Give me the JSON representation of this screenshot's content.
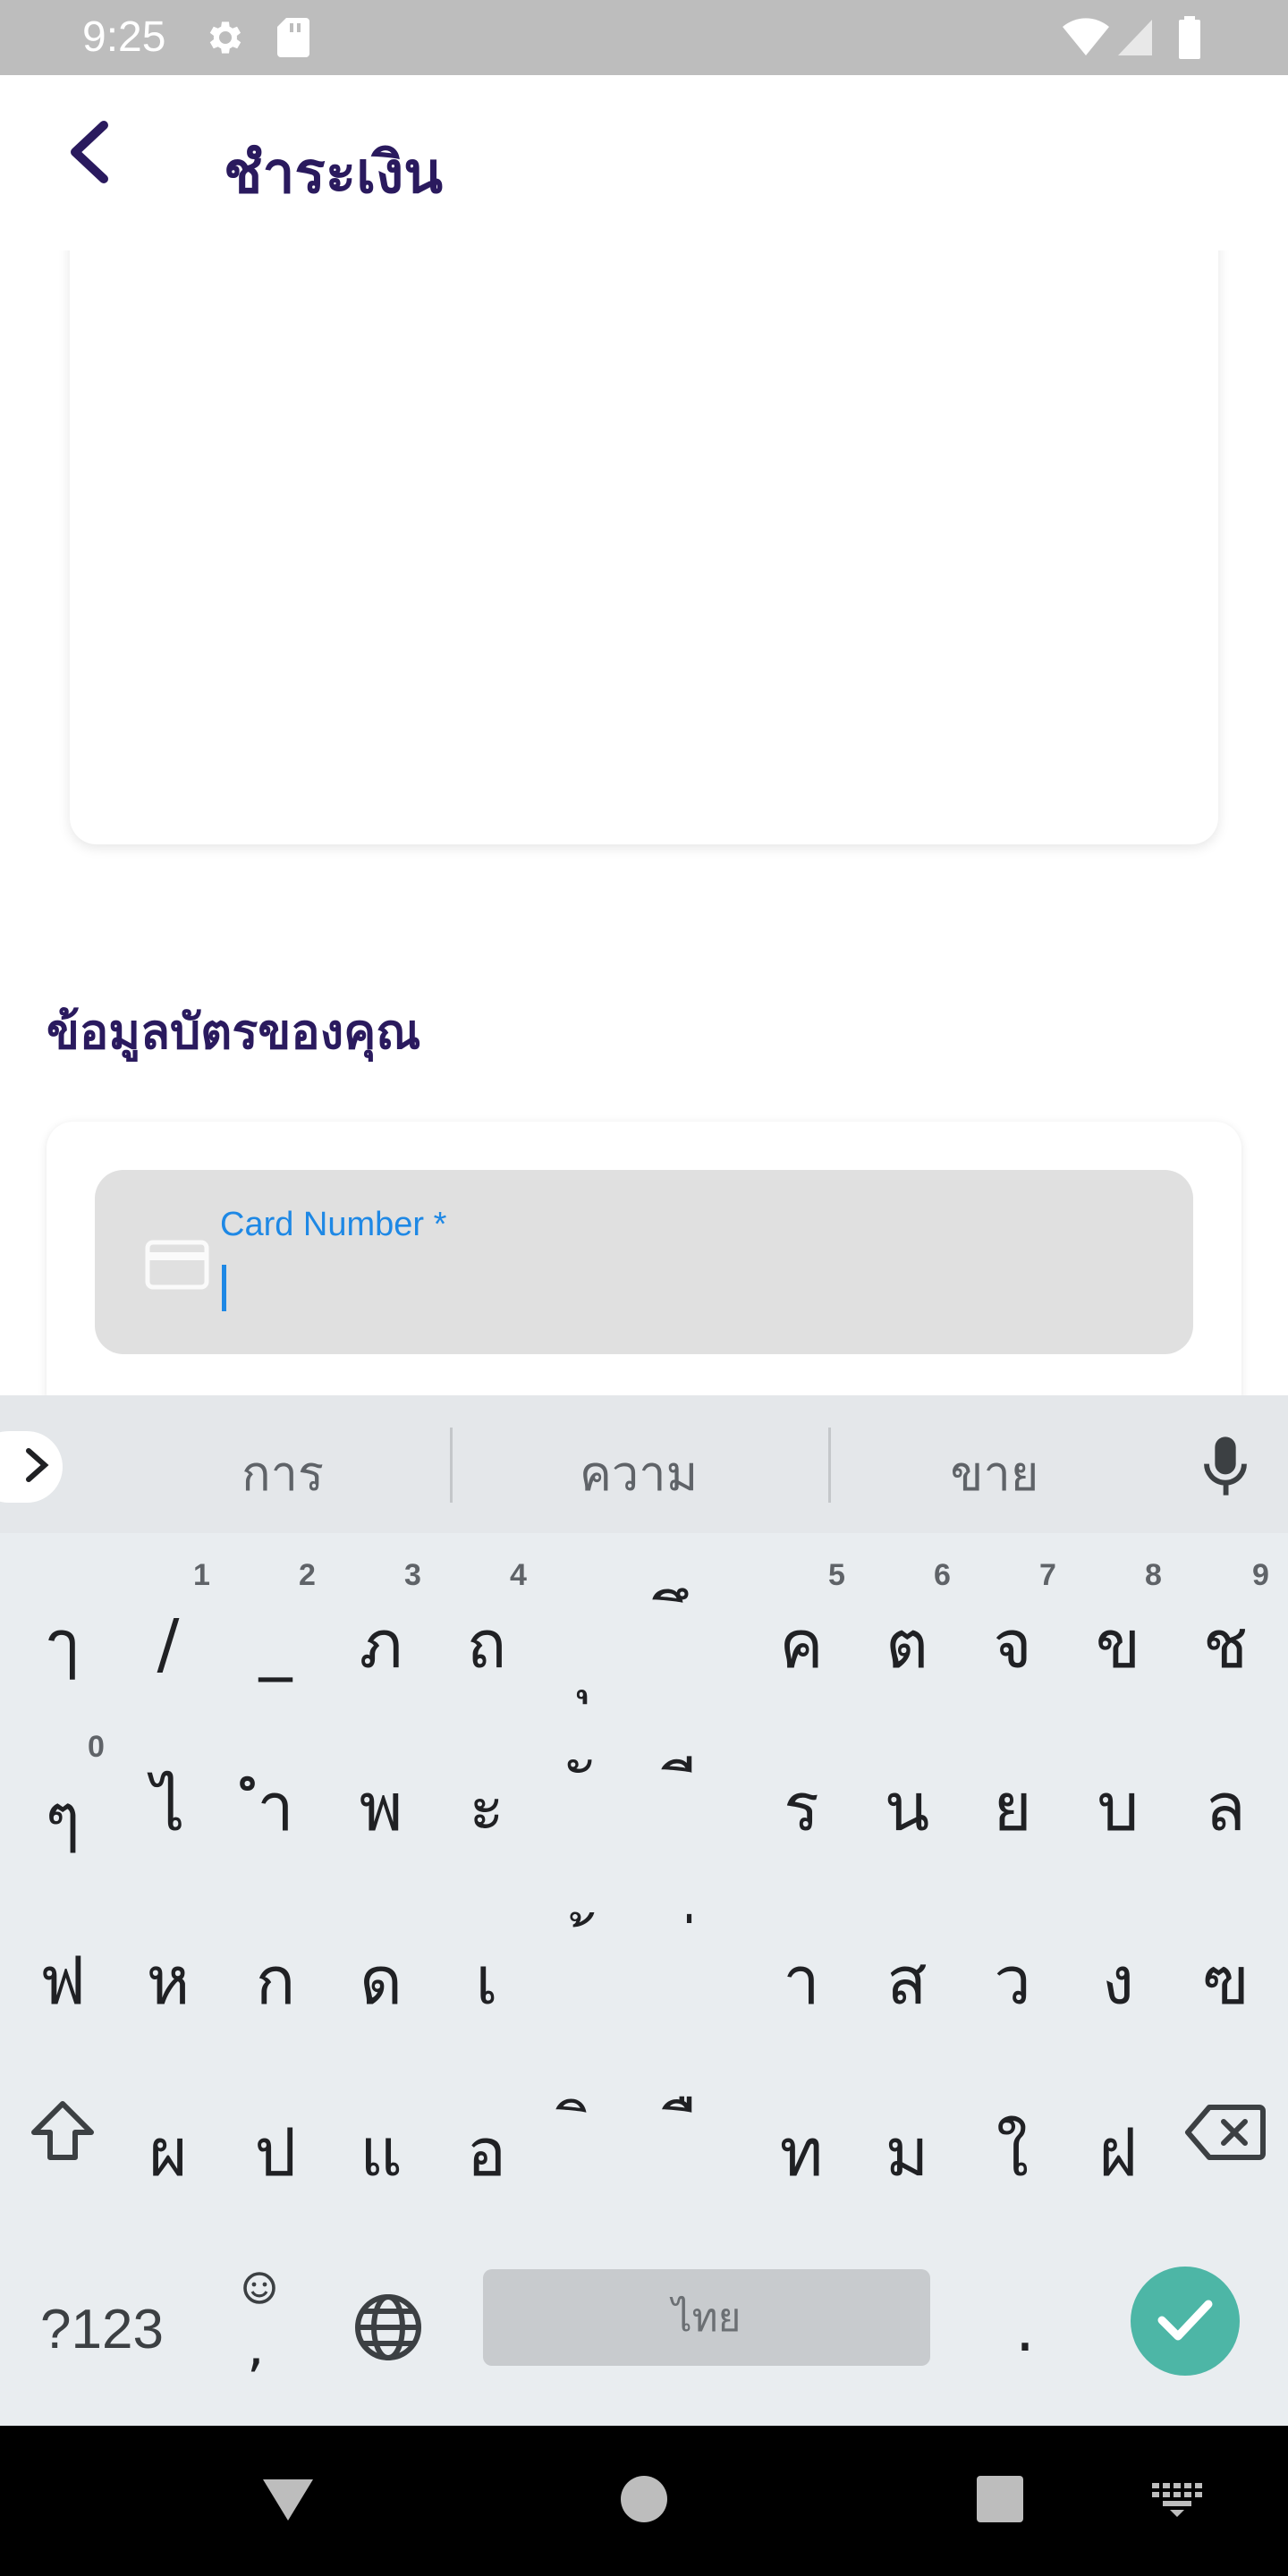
{
  "status_bar": {
    "time": "9:25",
    "left_icons": [
      "settings-icon",
      "sd-card-icon"
    ],
    "right_icons": [
      "wifi-icon",
      "signal-icon",
      "battery-icon"
    ]
  },
  "app_bar": {
    "title": "ชำระเงิน",
    "back_icon": "chevron-left-icon"
  },
  "section": {
    "title": "ข้อมูลบัตรของคุณ"
  },
  "card_form": {
    "card_number_label": "Card Number *",
    "card_number_value": "",
    "card_icon": "credit-card-icon"
  },
  "keyboard": {
    "suggestions": [
      "การ",
      "ความ",
      "ขาย"
    ],
    "rows": [
      {
        "keys": [
          "ๅ",
          "/",
          "_",
          "ภ",
          "ถ",
          "ุ",
          "ึ",
          "ค",
          "ต",
          "จ",
          "ข",
          "ช"
        ],
        "hints": [
          "",
          "1",
          "2",
          "3",
          "4",
          "",
          "",
          "5",
          "6",
          "7",
          "8",
          "9"
        ]
      },
      {
        "keys": [
          "ๆ",
          "ไ",
          "ำ",
          "พ",
          "ะ",
          "ั",
          "ี",
          "ร",
          "น",
          "ย",
          "บ",
          "ล"
        ],
        "hints": [
          "0",
          "",
          "",
          "",
          "",
          "",
          "",
          "",
          "",
          "",
          "",
          ""
        ]
      },
      {
        "keys": [
          "ฟ",
          "ห",
          "ก",
          "ด",
          "เ",
          "้",
          "่",
          "า",
          "ส",
          "ว",
          "ง",
          "ฃ"
        ],
        "hints": [
          "",
          "",
          "",
          "",
          "",
          "",
          "",
          "",
          "",
          "",
          "",
          ""
        ]
      },
      {
        "keys": [
          "ผ",
          "ป",
          "แ",
          "อ",
          "ิ",
          "ื",
          "ท",
          "ม",
          "ใ",
          "ฝ"
        ],
        "hints": [
          "",
          "",
          "",
          "",
          "",
          "",
          "",
          "",
          "",
          ""
        ]
      }
    ],
    "symbols_label": "?123",
    "comma_label": ",",
    "space_label": "ไทย",
    "period_label": ".",
    "icons": [
      "shift-icon",
      "backspace-icon",
      "emoji-icon",
      "globe-icon",
      "mic-icon",
      "check-icon"
    ]
  },
  "nav_bar": {
    "icons": [
      "back-triangle-icon",
      "home-circle-icon",
      "recents-square-icon",
      "keyboard-switch-icon"
    ]
  },
  "colors": {
    "title": "#2a1a5e",
    "accent": "#1e88e5",
    "enter": "#4db6a6",
    "status_bar": "#bdbdbd"
  }
}
